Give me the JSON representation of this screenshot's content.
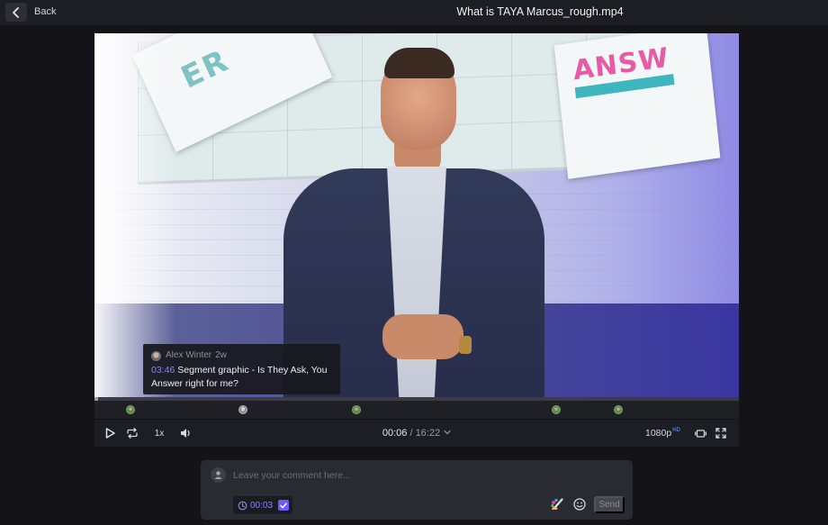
{
  "header": {
    "back_label": "Back",
    "file_title": "What is TAYA Marcus_rough.mp4"
  },
  "popup": {
    "author": "Alex Winter",
    "age": "2w",
    "timestamp": "03:46",
    "text": "Segment graphic - Is They Ask, You Answer right for me?"
  },
  "player": {
    "progress_fraction": 0.006,
    "speed": "1x",
    "current_time": "00:06",
    "separator": "/",
    "total_time": "16:22",
    "quality": "1080p",
    "quality_badge": "HD",
    "marker_positions_fraction": [
      0.056,
      0.231,
      0.406,
      0.717,
      0.813
    ]
  },
  "comment_box": {
    "placeholder": "Leave your comment here...",
    "timestamp": "00:03",
    "send_label": "Send"
  },
  "colors": {
    "accent": "#8b84ff",
    "marker_green": "#6fa866"
  },
  "icons": [
    "chevron-left-icon",
    "play-icon",
    "loop-icon",
    "volume-icon",
    "chevron-down-icon",
    "fit-screen-icon",
    "fullscreen-icon",
    "user-icon",
    "clock-icon",
    "check-icon",
    "draw-icon",
    "emoji-icon"
  ]
}
